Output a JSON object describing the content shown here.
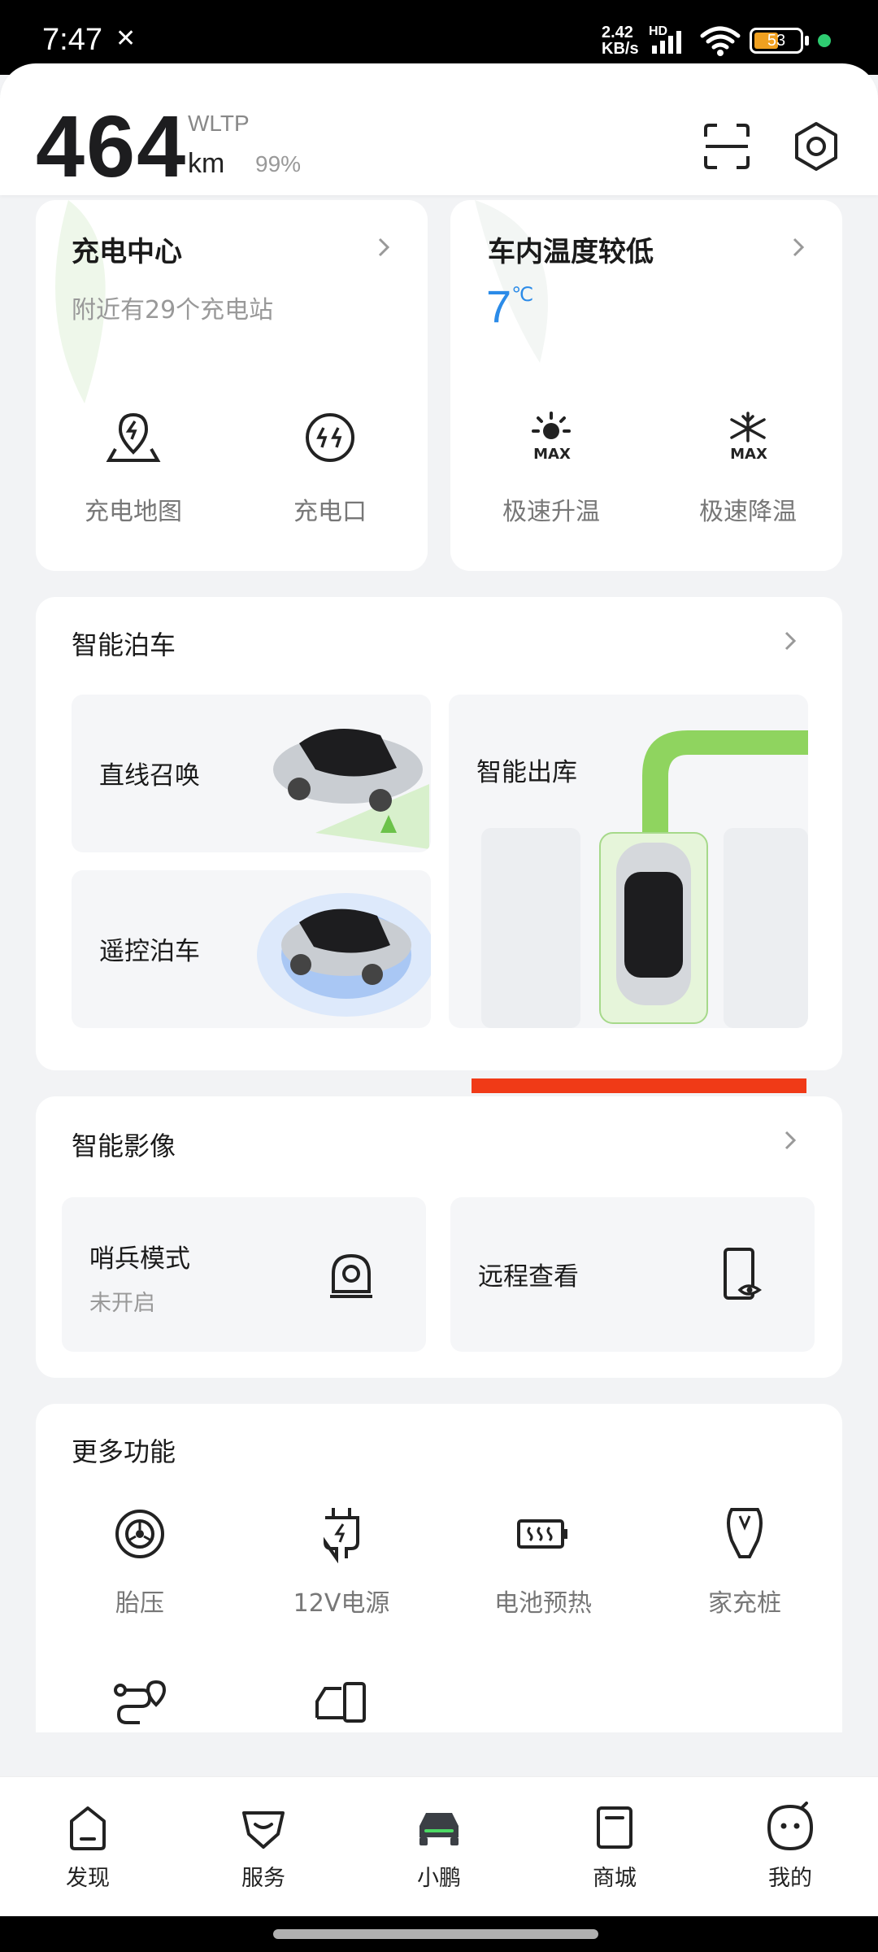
{
  "status_bar": {
    "time": "7:47",
    "network_speed_value": "2.42",
    "network_speed_unit": "KB/s",
    "network_hd": "HD",
    "battery_level": 53,
    "battery_text": "53",
    "battery_color": "#f0a020",
    "dot_color": "#2ecc71"
  },
  "header": {
    "range_value": "464",
    "range_standard": "WLTP",
    "range_unit": "km",
    "battery_percent": "99%",
    "scan_icon": "scan-icon",
    "settings_icon": "hexagon-settings-icon"
  },
  "charging_card": {
    "title": "充电中心",
    "subtitle": "附近有29个充电站",
    "items": [
      {
        "label": "充电地图",
        "icon": "charging-map-pin-icon"
      },
      {
        "label": "充电口",
        "icon": "charging-port-icon"
      }
    ]
  },
  "climate_card": {
    "title": "车内温度较低",
    "temperature": "7",
    "temperature_unit": "℃",
    "temperature_color": "#2b8be8",
    "items": [
      {
        "label": "极速升温",
        "icon": "sun-max-icon",
        "badge": "MAX"
      },
      {
        "label": "极速降温",
        "icon": "snowflake-max-icon",
        "badge": "MAX"
      }
    ]
  },
  "parking_card": {
    "title": "智能泊车",
    "tiles": [
      {
        "label": "直线召唤",
        "image": "car-summon-image"
      },
      {
        "label": "遥控泊车",
        "image": "car-remote-park-image"
      },
      {
        "label": "智能出库",
        "image": "car-auto-exit-image"
      }
    ],
    "accent_color": "#f03a17"
  },
  "camera_card": {
    "title": "智能影像",
    "tiles": [
      {
        "label": "哨兵模式",
        "status": "未开启",
        "icon": "sentry-camera-icon"
      },
      {
        "label": "远程查看",
        "icon": "remote-view-phone-icon"
      }
    ]
  },
  "more_card": {
    "title": "更多功能",
    "items": [
      {
        "label": "胎压",
        "icon": "tire-icon"
      },
      {
        "label": "12V电源",
        "icon": "plug-12v-icon"
      },
      {
        "label": "电池预热",
        "icon": "battery-heat-icon"
      },
      {
        "label": "家充桩",
        "icon": "home-charger-icon"
      }
    ],
    "partial_items": [
      {
        "icon": "route-pin-icon"
      },
      {
        "icon": "car-phone-icon"
      }
    ]
  },
  "bottom_nav": {
    "items": [
      {
        "label": "发现",
        "icon": "discover-icon"
      },
      {
        "label": "服务",
        "icon": "service-icon"
      },
      {
        "label": "小鹏",
        "icon": "car-icon",
        "active": true
      },
      {
        "label": "商城",
        "icon": "shop-icon"
      },
      {
        "label": "我的",
        "icon": "profile-icon"
      }
    ]
  }
}
